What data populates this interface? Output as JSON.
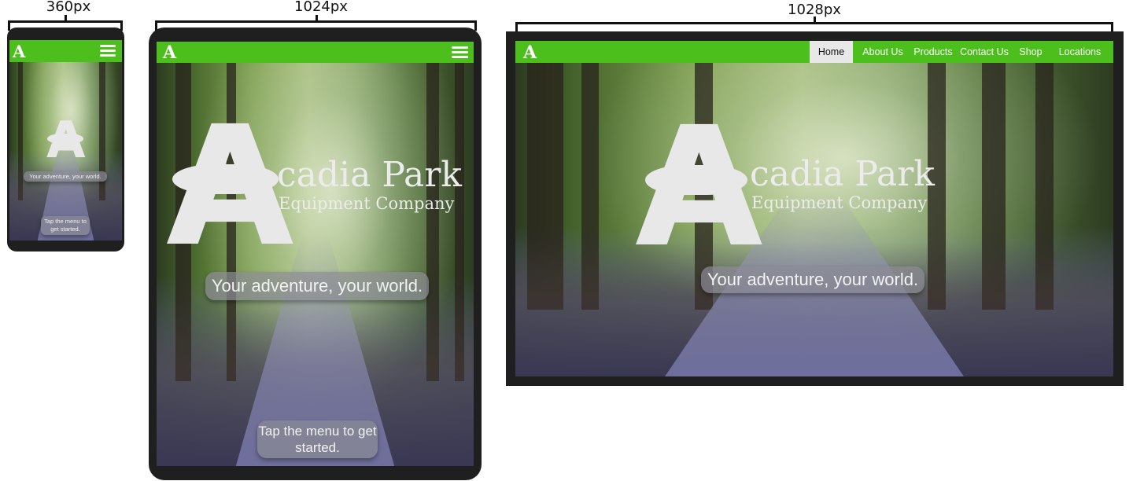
{
  "dimensions": {
    "mobile": "360px",
    "tablet": "1024px",
    "desktop": "1028px"
  },
  "brand": {
    "logo_letter": "A",
    "name": "cadia Park",
    "tagline": "Equipment Company",
    "color_green": "#4cbf1d",
    "color_device": "#1f1f1f"
  },
  "hero": {
    "slogan": "Your adventure, your world.",
    "cta": "Tap the menu to get started."
  },
  "nav": {
    "items": [
      {
        "label": "Home",
        "active": true
      },
      {
        "label": "About Us",
        "active": false
      },
      {
        "label": "Products",
        "active": false
      },
      {
        "label": "Contact Us",
        "active": false
      },
      {
        "label": "Shop",
        "active": false
      },
      {
        "label": "Locations",
        "active": false
      }
    ]
  }
}
